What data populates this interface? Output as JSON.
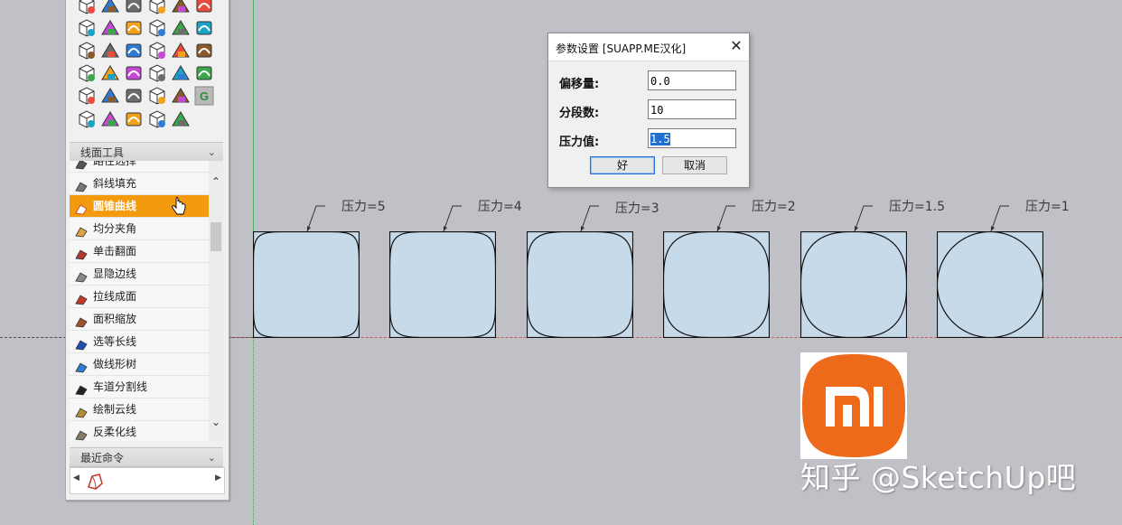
{
  "toolbar_panel": {
    "icons": [
      "cube-icon",
      "red-diamond-icon",
      "box-icon",
      "green-diamond-icon",
      "blue-frame-icon",
      "wave-icon",
      "scatter-icon",
      "grid-icon",
      "fire-icon",
      "triangle-icon",
      "puzzle-icon",
      "brick-icon",
      "pipe-icon",
      "dome-icon",
      "stack-icon",
      "arch-icon",
      "curve-icon",
      "cube-3d-icon",
      "paint-icon",
      "select-icon",
      "sofa-icon",
      "tree-icon",
      "leaf-icon",
      "roof-icon",
      "arrowhead-icon",
      "mesh-icon",
      "panel-icon",
      "frame-icon",
      "wood-icon",
      "g-button-icon",
      "dial-icon",
      "bridge-icon",
      "tap-icon",
      "books-icon",
      "m-cube-icon"
    ],
    "section_title": "线面工具",
    "tools": [
      {
        "label": "路径选择",
        "active": false
      },
      {
        "label": "斜线填充",
        "active": false
      },
      {
        "label": "圆锥曲线",
        "active": true
      },
      {
        "label": "均分夹角",
        "active": false
      },
      {
        "label": "单击翻面",
        "active": false
      },
      {
        "label": "显隐边线",
        "active": false
      },
      {
        "label": "拉线成面",
        "active": false
      },
      {
        "label": "面积缩放",
        "active": false
      },
      {
        "label": "选等长线",
        "active": false
      },
      {
        "label": "做线形树",
        "active": false
      },
      {
        "label": "车道分割线",
        "active": false
      },
      {
        "label": "绘制云线",
        "active": false
      },
      {
        "label": "反柔化线",
        "active": false
      }
    ],
    "recent_title": "最近命令"
  },
  "dialog": {
    "title": "参数设置 [SUAPP.ME汉化]",
    "fields": [
      {
        "label": "偏移量:",
        "value": "0.0"
      },
      {
        "label": "分段数:",
        "value": "10"
      },
      {
        "label": "压力值:",
        "value": "1.5"
      }
    ],
    "ok_label": "好",
    "cancel_label": "取消"
  },
  "shapes": [
    {
      "label": "压力=5",
      "pressure": 5
    },
    {
      "label": "压力=4",
      "pressure": 4
    },
    {
      "label": "压力=3",
      "pressure": 3
    },
    {
      "label": "压力=2",
      "pressure": 2
    },
    {
      "label": "压力=1.5",
      "pressure": 1.5
    },
    {
      "label": "压力=1",
      "pressure": 1
    }
  ],
  "colors": {
    "shape_fill": "#c6daea",
    "accent": "#f39a0f",
    "logo_orange": "#ec6a1a"
  },
  "watermark": "知乎 @SketchUp吧"
}
